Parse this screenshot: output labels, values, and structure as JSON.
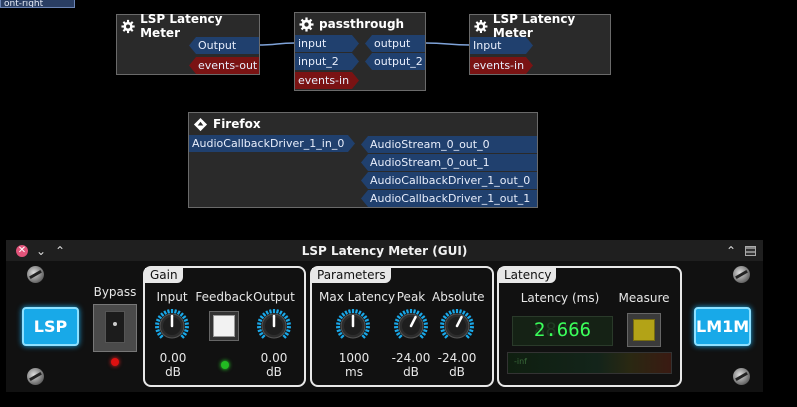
{
  "patchbay": {
    "clipped_node_label": "ont-right",
    "node1": {
      "title": "LSP Latency Meter",
      "ports": [
        "Output",
        "events-out"
      ]
    },
    "passthrough": {
      "title": "passthrough",
      "inputs": [
        "input",
        "input_2",
        "events-in"
      ],
      "outputs": [
        "output",
        "output_2"
      ]
    },
    "node3": {
      "title": "LSP Latency Meter",
      "ports": [
        "Input",
        "events-in"
      ]
    },
    "firefox": {
      "title": "Firefox",
      "inputs": [
        "AudioCallbackDriver_1_in_0"
      ],
      "outputs": [
        "AudioStream_0_out_0",
        "AudioStream_0_out_1",
        "AudioCallbackDriver_1_out_0",
        "AudioCallbackDriver_1_out_1"
      ]
    }
  },
  "plugin": {
    "title": "LSP Latency Meter (GUI)",
    "close_glyph": "✕",
    "lsp_logo": "LSP",
    "model_logo": "LM1M",
    "bypass_label": "Bypass",
    "gain": {
      "group": "Gain",
      "input_label": "Input",
      "feedback_label": "Feedback",
      "output_label": "Output",
      "input_value": "0.00",
      "input_unit": "dB",
      "output_value": "0.00",
      "output_unit": "dB",
      "input_level": 0.5,
      "output_level": 0.5
    },
    "parameters": {
      "group": "Parameters",
      "max_latency_label": "Max Latency",
      "peak_label": "Peak",
      "absolute_label": "Absolute",
      "max_latency_value": "1000",
      "max_latency_unit": "ms",
      "peak_value": "-24.00",
      "peak_unit": "dB",
      "absolute_value": "-24.00",
      "absolute_unit": "dB",
      "max_latency_level": 0.5,
      "peak_level": 0.6,
      "absolute_level": 0.6
    },
    "latency": {
      "group": "Latency",
      "latency_label": "Latency (ms)",
      "measure_label": "Measure",
      "readout": "2.666",
      "readout_ghost": "88888",
      "meter_label": "-inf"
    },
    "colors": {
      "knob_arc": "#1aa8e8",
      "lcd_text": "#3aff5a",
      "led_red": "#d11",
      "led_green": "#2b2"
    }
  }
}
